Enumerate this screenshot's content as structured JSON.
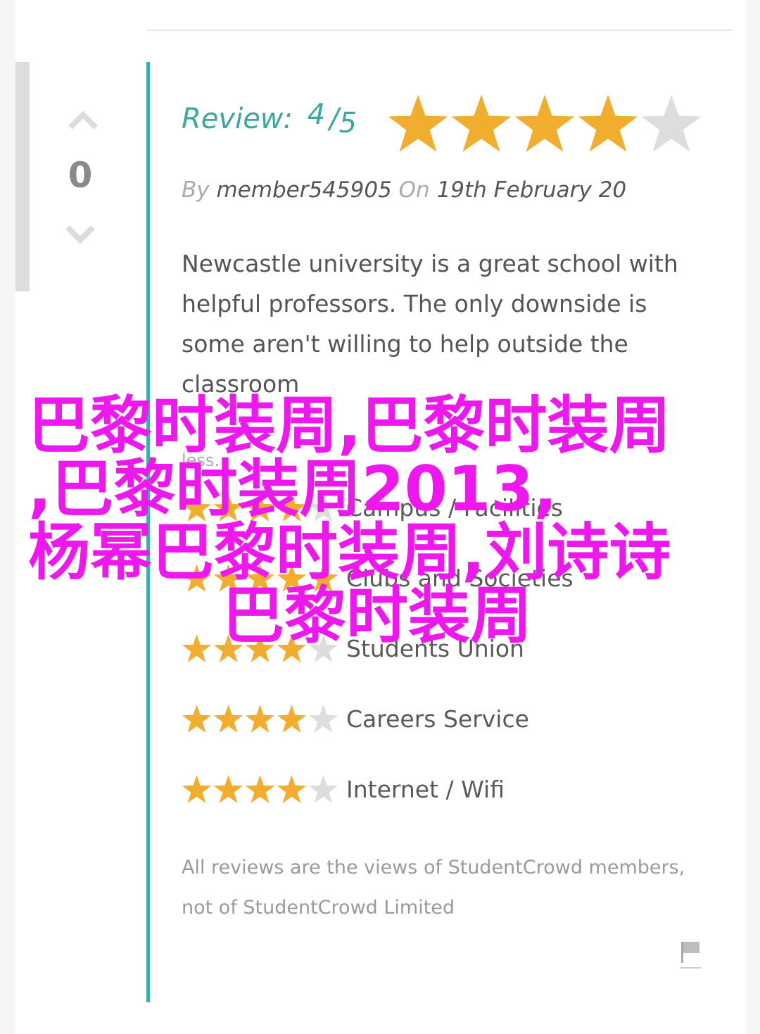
{
  "colors": {
    "accent": "#3bb0a8",
    "star_on": "#f0ad2e",
    "star_off": "#dddddd",
    "watermark": "#ee18ee"
  },
  "vote": {
    "count": "0",
    "up_icon": "chevron-up-icon",
    "down_icon": "chevron-down-icon"
  },
  "review": {
    "label": "Review:",
    "score": "4",
    "out_of": "5",
    "rating": 4,
    "by_label": "By",
    "author": "member545905",
    "on_label": "On",
    "date": "19th February 20",
    "body": "Newcastle university is a great school with helpful professors. The only downside is some aren't willing to help outside the classroom",
    "less_label": "less."
  },
  "categories": [
    {
      "label": "Campus / Facilities",
      "rating": 4
    },
    {
      "label": "Clubs and Societies",
      "rating": 5
    },
    {
      "label": "Students Union",
      "rating": 4
    },
    {
      "label": "Careers Service",
      "rating": 4
    },
    {
      "label": "Internet / Wifi",
      "rating": 4
    }
  ],
  "disclaimer": "All reviews are the views of StudentCrowd members, not of StudentCrowd Limited",
  "flag_icon": "flag-icon",
  "watermark": {
    "line1": "巴黎时装周,巴黎时装周",
    "line2": ",巴黎时装周2013,",
    "line3": "杨幂巴黎时装周,刘诗诗",
    "line4": "巴黎时装周"
  }
}
